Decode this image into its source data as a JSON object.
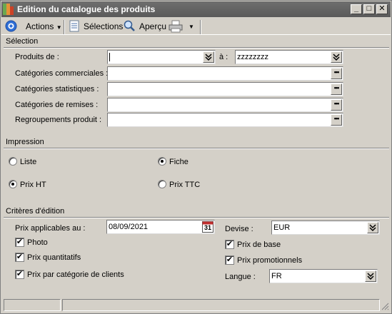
{
  "window": {
    "title": "Edition du catalogue des produits",
    "minimize": "_",
    "maximize": "□",
    "close": "✕"
  },
  "toolbar": {
    "actions_label": "Actions",
    "selections_label": "Sélections",
    "apercu_label": "Aperçu"
  },
  "selection": {
    "group_label": "Sélection",
    "produits_label": "Produits de :",
    "produits_from_value": "",
    "produits_a_label": "à :",
    "produits_to_value": "zzzzzzzz",
    "cat_commerciales_label": "Catégories commerciales :",
    "cat_statistiques_label": "Catégories statistiques :",
    "cat_remises_label": "Catégories de remises :",
    "regroupements_label": "Regroupements produit :",
    "dots": "•••"
  },
  "impression": {
    "group_label": "Impression",
    "liste_label": "Liste",
    "liste_selected": false,
    "fiche_label": "Fiche",
    "fiche_selected": true,
    "prix_ht_label": "Prix HT",
    "prix_ht_selected": true,
    "prix_ttc_label": "Prix TTC",
    "prix_ttc_selected": false
  },
  "criteres": {
    "group_label": "Critères d'édition",
    "prix_applicables_label": "Prix applicables au :",
    "prix_applicables_value": "08/09/2021",
    "calendar_day": "31",
    "photo_label": "Photo",
    "photo_checked": true,
    "prix_quantitatifs_label": "Prix quantitatifs",
    "prix_quantitatifs_checked": true,
    "prix_par_categorie_label": "Prix par catégorie de clients",
    "prix_par_categorie_checked": true,
    "devise_label": "Devise :",
    "devise_value": "EUR",
    "prix_base_label": "Prix de base",
    "prix_base_checked": true,
    "prix_promo_label": "Prix promotionnels",
    "prix_promo_checked": true,
    "langue_label": "Langue :",
    "langue_value": "FR"
  },
  "icons": {
    "check_mark": "✔",
    "dropdown_arrow": "▼",
    "double_chevron": "»"
  }
}
